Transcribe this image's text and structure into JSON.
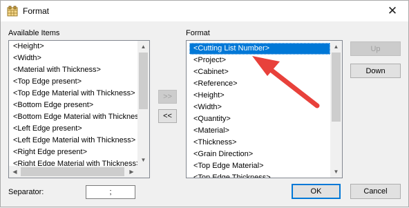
{
  "window": {
    "title": "Format",
    "icon": "format-grid-icon",
    "close_glyph": "✕"
  },
  "available": {
    "label": "Available Items",
    "items": [
      "<Height>",
      "<Width>",
      "<Material with Thickness>",
      "<Top Edge present>",
      "<Top Edge Material with Thickness>",
      "<Bottom Edge present>",
      "<Bottom Edge Material with Thickness>",
      "<Left Edge present>",
      "<Left Edge Material with Thickness>",
      "<Right Edge present>",
      "<Right Edge Material with Thickness>"
    ]
  },
  "transfer": {
    "add_label": ">>",
    "remove_label": "<<"
  },
  "format": {
    "label": "Format",
    "items": [
      "<Cutting List Number>",
      "<Project>",
      "<Cabinet>",
      "<Reference>",
      "<Height>",
      "<Width>",
      "<Quantity>",
      "<Material>",
      "<Thickness>",
      "<Grain Direction>",
      "<Top Edge Material>",
      "<Top Edge Thickness>"
    ],
    "selected_index": 0
  },
  "buttons": {
    "up": "Up",
    "down": "Down",
    "ok": "OK",
    "cancel": "Cancel"
  },
  "separator": {
    "label": "Separator:",
    "value": ";"
  },
  "colors": {
    "selection": "#0078d7",
    "annotation_arrow": "#e8413b"
  }
}
